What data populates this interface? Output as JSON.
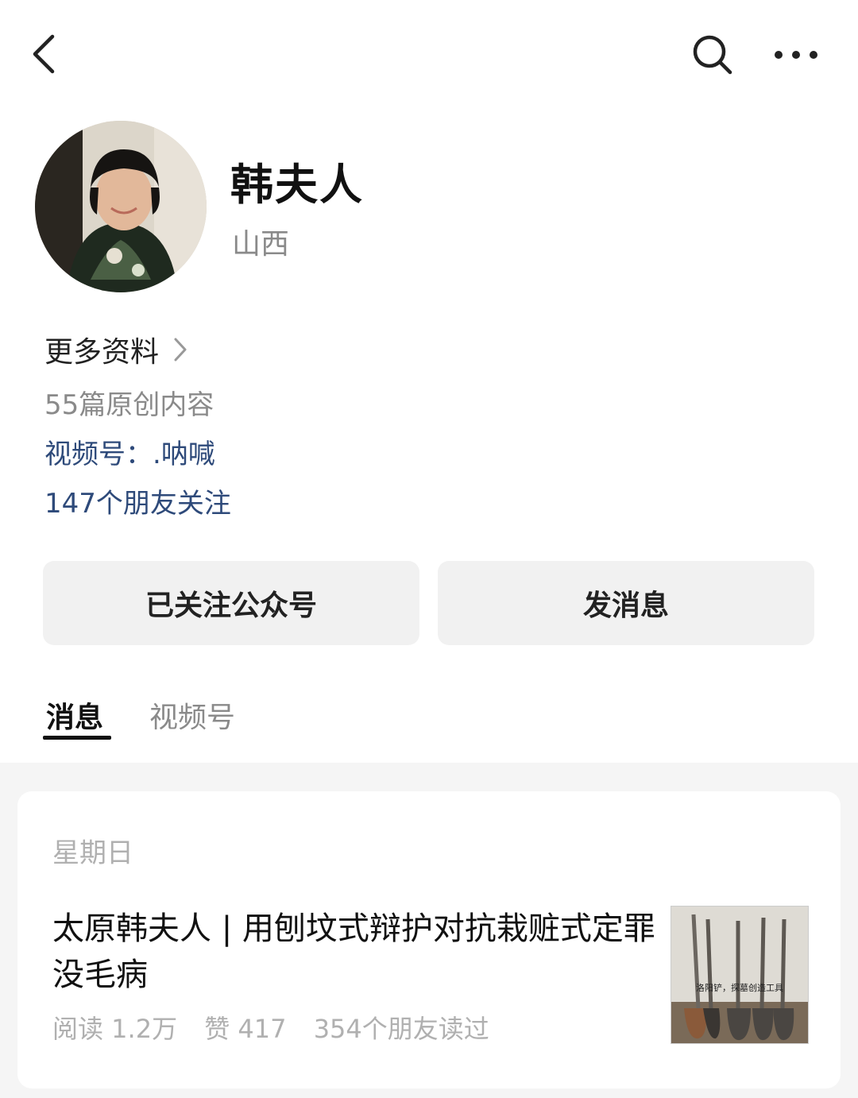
{
  "header": {
    "back_icon": "chevron-left-icon",
    "search_icon": "search-icon",
    "more_icon": "more-dots-icon"
  },
  "profile": {
    "name": "韩夫人",
    "region": "山西",
    "more_info_label": "更多资料",
    "originals": "55篇原创内容",
    "channels": "视频号：.呐喊",
    "friends_following": "147个朋友关注"
  },
  "actions": {
    "follow_label": "已关注公众号",
    "message_label": "发消息"
  },
  "tabs": [
    {
      "label": "消息",
      "active": true
    },
    {
      "label": "视频号",
      "active": false
    }
  ],
  "feed": {
    "items": [
      {
        "date": "星期日",
        "title": "太原韩夫人 | 用刨坟式辩护对抗栽赃式定罪没毛病",
        "reads": "阅读 1.2万",
        "likes": "赞 417",
        "friends_read": "354个朋友读过",
        "thumbnail_caption": "洛阳铲，探墓创造工具"
      }
    ]
  },
  "colors": {
    "link": "#2e4a7a",
    "muted": "#8a8a8a",
    "button_bg": "#f1f1f1"
  }
}
